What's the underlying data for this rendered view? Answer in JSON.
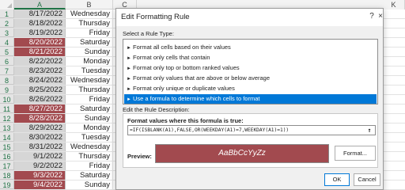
{
  "spreadsheet": {
    "columns": [
      "A",
      "B",
      "C",
      "K"
    ],
    "rows": [
      {
        "num": "1",
        "date": "8/17/2022",
        "day": "Wednesday",
        "highlight": false
      },
      {
        "num": "2",
        "date": "8/18/2022",
        "day": "Thursday",
        "highlight": false
      },
      {
        "num": "3",
        "date": "8/19/2022",
        "day": "Friday",
        "highlight": false
      },
      {
        "num": "4",
        "date": "8/20/2022",
        "day": "Saturday",
        "highlight": true
      },
      {
        "num": "5",
        "date": "8/21/2022",
        "day": "Sunday",
        "highlight": true
      },
      {
        "num": "6",
        "date": "8/22/2022",
        "day": "Monday",
        "highlight": false
      },
      {
        "num": "7",
        "date": "8/23/2022",
        "day": "Tuesday",
        "highlight": false
      },
      {
        "num": "8",
        "date": "8/24/2022",
        "day": "Wednesday",
        "highlight": false
      },
      {
        "num": "9",
        "date": "8/25/2022",
        "day": "Thursday",
        "highlight": false
      },
      {
        "num": "10",
        "date": "8/26/2022",
        "day": "Friday",
        "highlight": false
      },
      {
        "num": "11",
        "date": "8/27/2022",
        "day": "Saturday",
        "highlight": true
      },
      {
        "num": "12",
        "date": "8/28/2022",
        "day": "Sunday",
        "highlight": true
      },
      {
        "num": "13",
        "date": "8/29/2022",
        "day": "Monday",
        "highlight": false
      },
      {
        "num": "14",
        "date": "8/30/2022",
        "day": "Tuesday",
        "highlight": false
      },
      {
        "num": "15",
        "date": "8/31/2022",
        "day": "Wednesday",
        "highlight": false
      },
      {
        "num": "16",
        "date": "9/1/2022",
        "day": "Thursday",
        "highlight": false
      },
      {
        "num": "17",
        "date": "9/2/2022",
        "day": "Friday",
        "highlight": false
      },
      {
        "num": "18",
        "date": "9/3/2022",
        "day": "Saturday",
        "highlight": true
      },
      {
        "num": "19",
        "date": "9/4/2022",
        "day": "Sunday",
        "highlight": true
      }
    ],
    "highlight_color": "#a24a4f",
    "column_a_bg": "#d6d6d6"
  },
  "dialog": {
    "title": "Edit Formatting Rule",
    "help_icon": "?",
    "close_icon": "×",
    "rule_type_label": "Select a Rule Type:",
    "rule_types": [
      "Format all cells based on their values",
      "Format only cells that contain",
      "Format only top or bottom ranked values",
      "Format only values that are above or below average",
      "Format only unique or duplicate values",
      "Use a formula to determine which cells to format"
    ],
    "selected_rule_index": 5,
    "description_label": "Edit the Rule Description:",
    "formula_label": "Format values where this formula is true:",
    "formula_value": "=IF(ISBLANK(A1),FALSE,OR(WEEKDAY(A1)=7,WEEKDAY(A1)=1))",
    "collapse_icon": "↑",
    "preview_label": "Preview:",
    "preview_text": "AaBbCcYyZz",
    "format_button": "Format...",
    "ok_button": "OK",
    "cancel_button": "Cancel",
    "accent_color": "#0078d7"
  }
}
